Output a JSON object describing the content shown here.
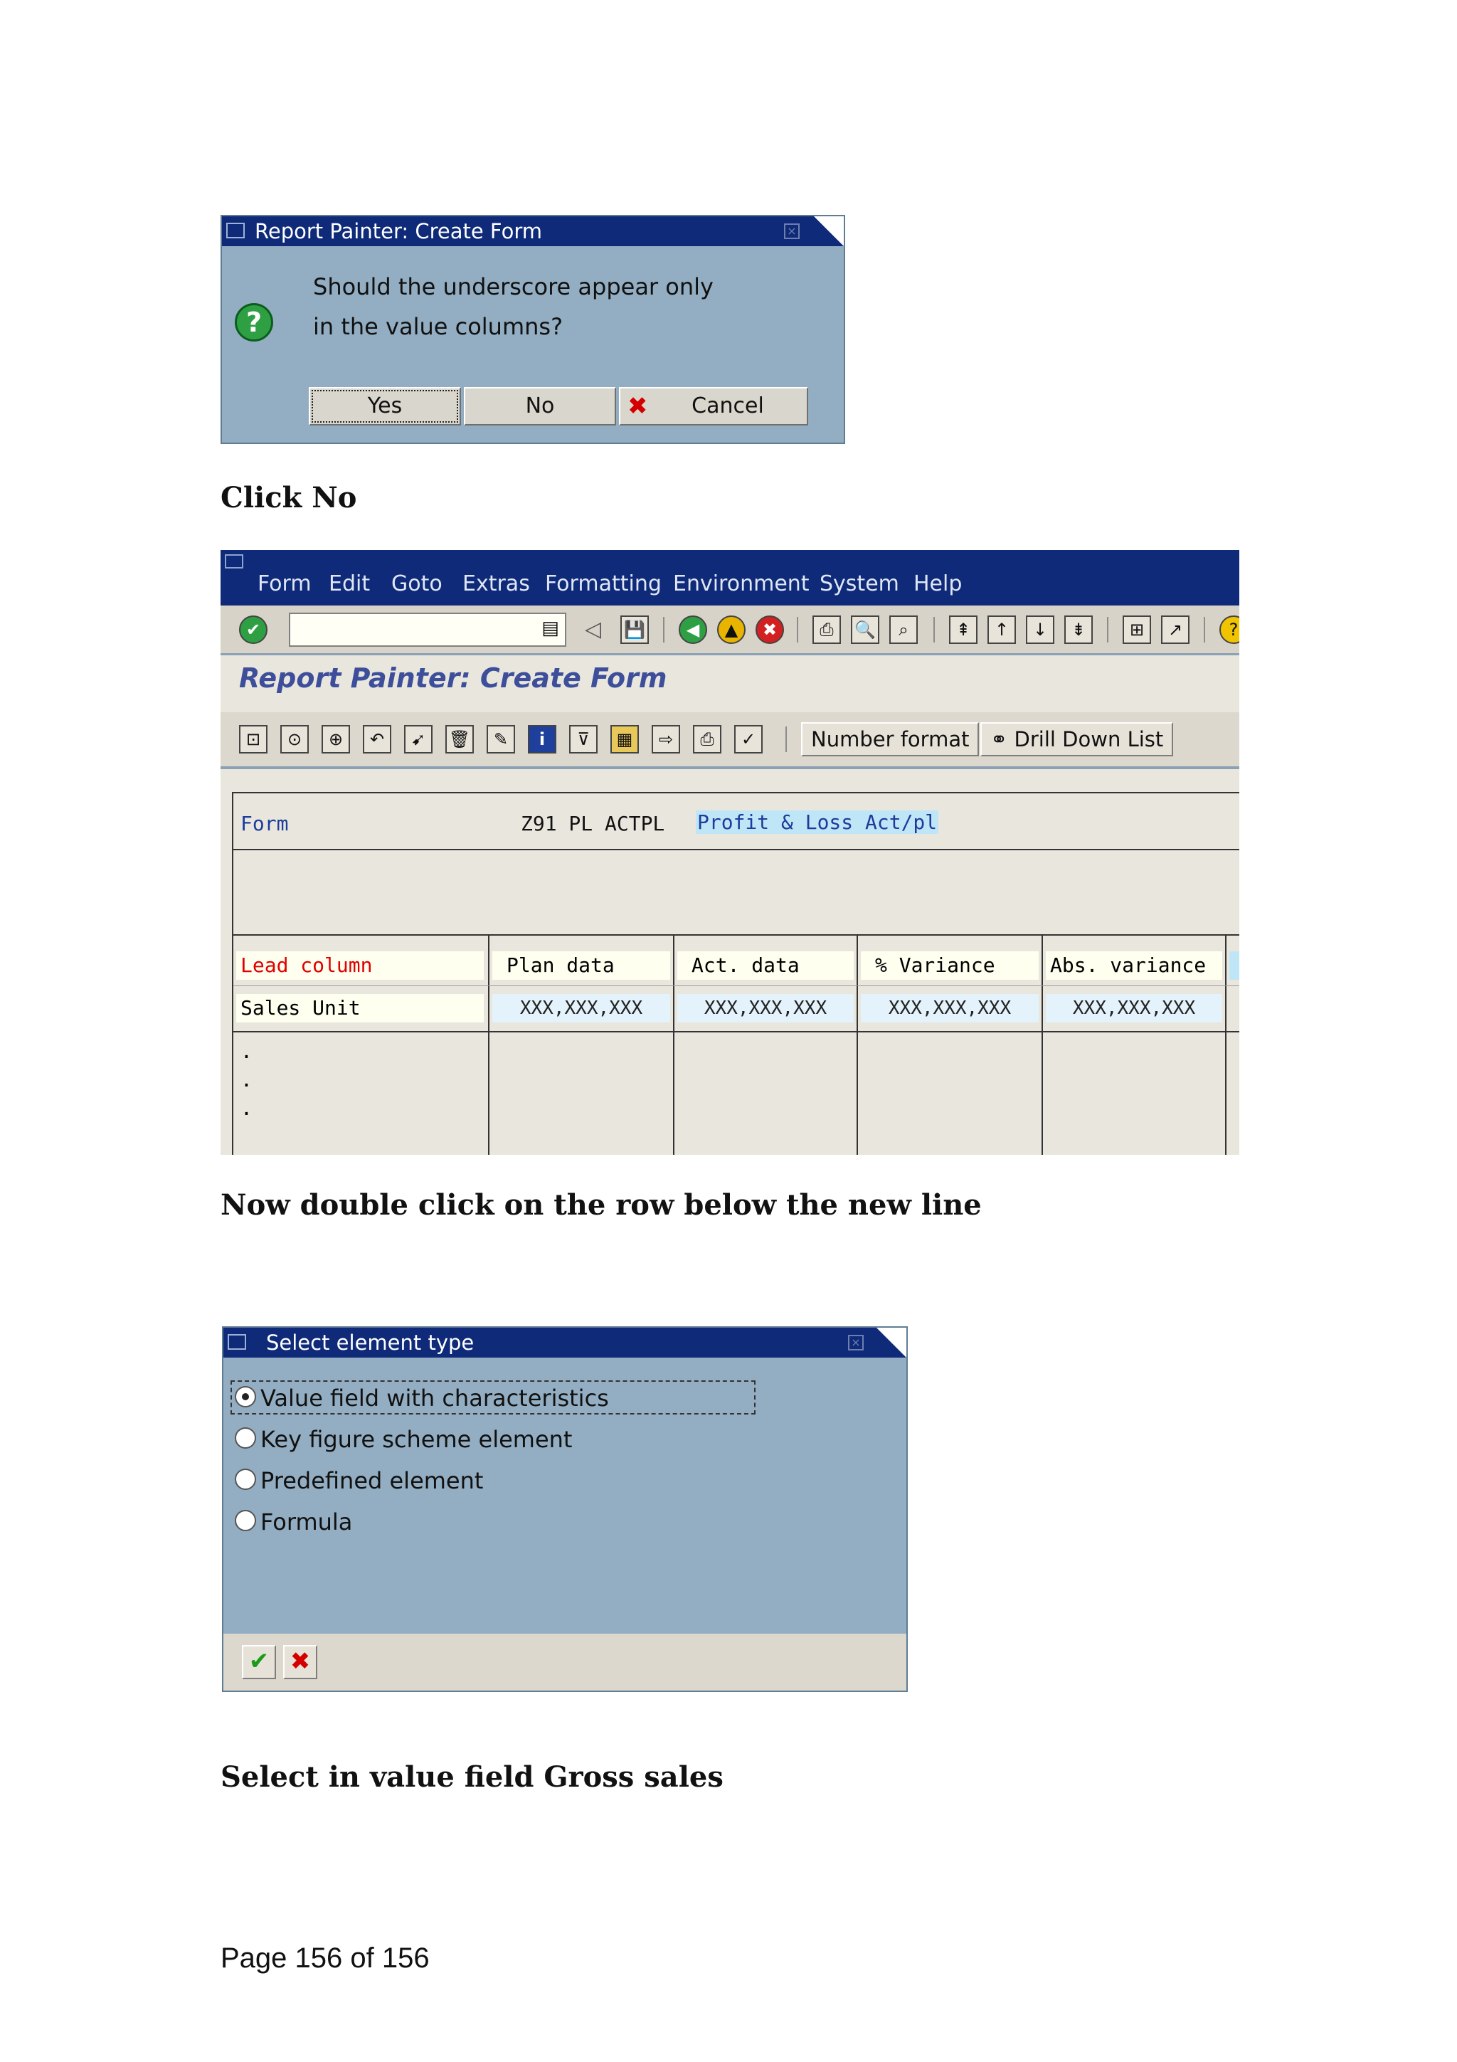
{
  "dialog1": {
    "title": "Report Painter: Create Form",
    "question_line1": "Should the underscore appear only",
    "question_line2": "in the value columns?",
    "buttons": {
      "yes": "Yes",
      "no": "No",
      "cancel": "Cancel"
    }
  },
  "instruction1": "Click No",
  "sap": {
    "menu": [
      "Form",
      "Edit",
      "Goto",
      "Extras",
      "Formatting",
      "Environment",
      "System",
      "Help"
    ],
    "screen_title": "Report Painter: Create Form",
    "toolbar2": {
      "number_format": "Number format",
      "drill_down": "Drill Down List"
    },
    "form_label": "Form",
    "form_id": "Z91 PL ACTPL",
    "form_desc": "Profit & Loss Act/pl",
    "lead_column": "Lead column",
    "columns": [
      "Plan data",
      "Act. data",
      "% Variance",
      "Abs. variance"
    ],
    "row_label": "Sales Unit",
    "row_values": [
      "XXX,XXX,XXX",
      "XXX,XXX,XXX",
      "XXX,XXX,XXX",
      "XXX,XXX,XXX"
    ],
    "dots": [
      ".",
      ".",
      "."
    ]
  },
  "instruction2": "Now double click on the row below the new line",
  "dialog2": {
    "title": "Select element type",
    "options": [
      "Value field with characteristics",
      "Key figure scheme element",
      "Predefined element",
      "Formula"
    ],
    "selected_index": 0
  },
  "instruction3": "Select in value field Gross sales",
  "footer": "Page 156 of 156",
  "colors": {
    "titlebar": "#0e2a78",
    "dialog_bg": "#93aec2",
    "lead_column_text": "#e00000",
    "form_text": "#1c3c9c"
  }
}
